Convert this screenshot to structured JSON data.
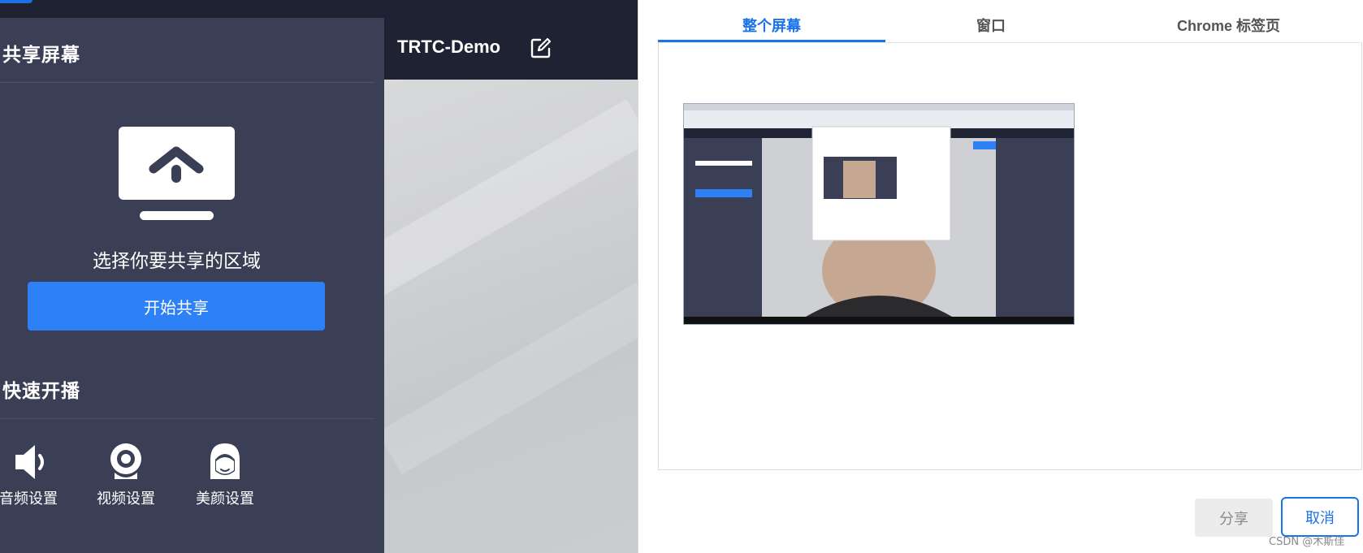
{
  "left_panel": {
    "share_section_title": "共享屏幕",
    "choose_area_text": "选择你要共享的区域",
    "start_share_label": "开始共享",
    "quick_section_title": "快速开播",
    "quick_items": [
      {
        "label": "音频设置",
        "icon": "speaker-icon"
      },
      {
        "label": "视频设置",
        "icon": "webcam-icon"
      },
      {
        "label": "美颜设置",
        "icon": "beauty-face-icon"
      }
    ]
  },
  "video_header": {
    "room_title": "TRTC-Demo",
    "edit_icon": "edit-icon"
  },
  "dialog": {
    "tabs": [
      {
        "label": "整个屏幕",
        "active": true
      },
      {
        "label": "窗口",
        "active": false
      },
      {
        "label": "Chrome 标签页",
        "active": false
      }
    ],
    "share_label": "分享",
    "cancel_label": "取消"
  },
  "watermark": "CSDN @木斯佳",
  "colors": {
    "accent": "#1a73e8",
    "primary_button": "#2d80f5",
    "panel_bg": "#3a3f55",
    "header_bg": "#1e2232"
  }
}
